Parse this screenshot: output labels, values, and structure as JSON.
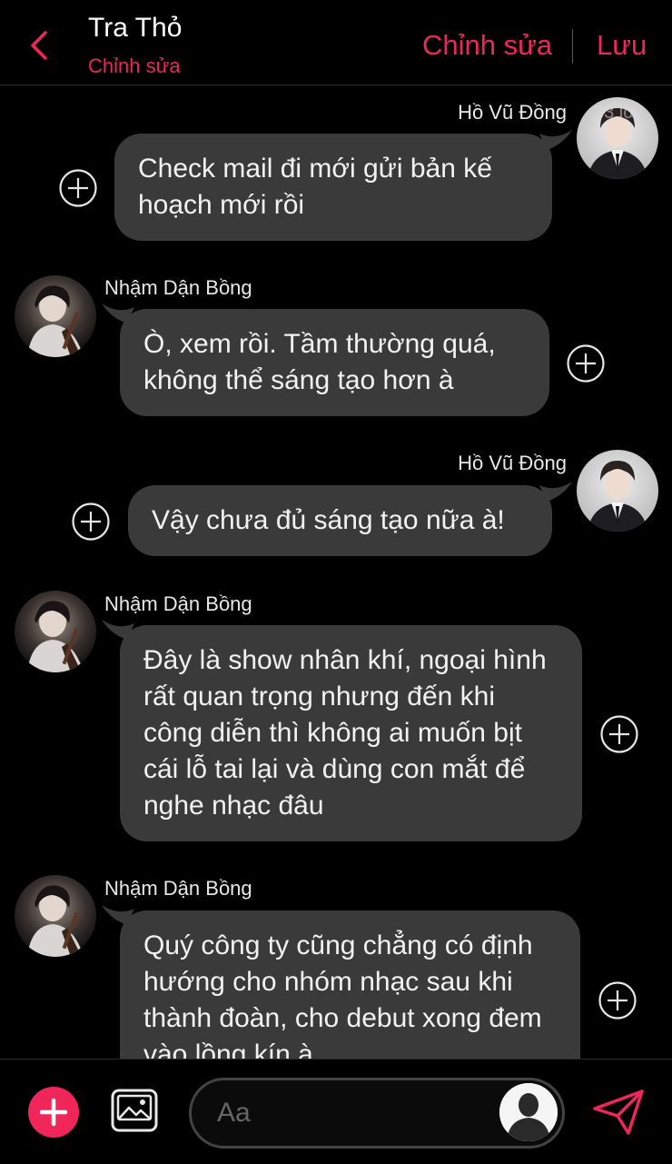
{
  "header": {
    "title": "Tra Thỏ",
    "subtitle": "Chỉnh sửa",
    "edit_label": "Chỉnh sửa",
    "save_label": "Lưu"
  },
  "watermark": "33 joy",
  "messages": [
    {
      "sender": "Hồ Vũ Đồng",
      "side": "right",
      "text": "Check mail đi mới gửi bản kế hoạch mới rồi"
    },
    {
      "sender": "Nhậm Dận Bồng",
      "side": "left",
      "text": "Ò, xem rồi. Tầm thường quá, không thể sáng tạo hơn à"
    },
    {
      "sender": "Hồ Vũ Đồng",
      "side": "right",
      "text": "Vậy chưa đủ sáng tạo nữa à!"
    },
    {
      "sender": "Nhậm Dận Bồng",
      "side": "left",
      "text": "Đây là show nhân khí, ngoại hình rất quan trọng nhưng đến khi công diễn thì không ai muốn bịt cái lỗ tai lại và dùng con mắt để nghe nhạc đâu"
    },
    {
      "sender": "Nhậm Dận Bồng",
      "side": "left",
      "text": "Quý công ty cũng chẳng có định hướng cho nhóm nhạc sau khi thành đoàn, cho debut xong đem vào lồng kín à"
    }
  ],
  "composer": {
    "placeholder": "Aa"
  },
  "colors": {
    "accent": "#f0255a",
    "bubble": "#3a3a3a",
    "background": "#000000"
  },
  "icons": [
    "chevron-left-icon",
    "add-message-icon",
    "plus-icon",
    "image-icon",
    "user-avatar-icon",
    "send-icon"
  ]
}
